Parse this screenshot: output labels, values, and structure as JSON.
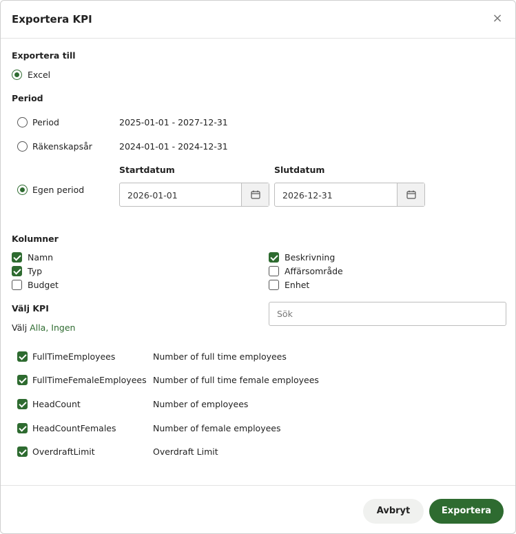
{
  "dialog": {
    "title": "Exportera KPI",
    "close_symbol": "×"
  },
  "export_to": {
    "label": "Exportera till",
    "option": "Excel"
  },
  "period": {
    "label": "Period",
    "options": [
      {
        "label": "Period",
        "range": "2025-01-01 - 2027-12-31"
      },
      {
        "label": "Räkenskapsår",
        "range": "2024-01-01 - 2024-12-31"
      },
      {
        "label": "Egen period"
      }
    ],
    "start_label": "Startdatum",
    "end_label": "Slutdatum",
    "start_value": "2026-01-01",
    "end_value": "2026-12-31"
  },
  "columns": {
    "label": "Kolumner",
    "items": [
      {
        "label": "Namn",
        "checked": true
      },
      {
        "label": "Typ",
        "checked": true
      },
      {
        "label": "Budget",
        "checked": false
      },
      {
        "label": "Beskrivning",
        "checked": true
      },
      {
        "label": "Affärsområde",
        "checked": false
      },
      {
        "label": "Enhet",
        "checked": false
      }
    ]
  },
  "kpi": {
    "label": "Välj KPI",
    "select_prefix": "Välj",
    "select_all": "Alla,",
    "select_none": "Ingen",
    "search_placeholder": "Sök",
    "items": [
      {
        "name": "FullTimeEmployees",
        "description": "Number of full time employees"
      },
      {
        "name": "FullTimeFemaleEmployees",
        "description": "Number of full time female employees"
      },
      {
        "name": "HeadCount",
        "description": "Number of employees"
      },
      {
        "name": "HeadCountFemales",
        "description": "Number of female employees"
      },
      {
        "name": "OverdraftLimit",
        "description": "Overdraft Limit"
      }
    ]
  },
  "footer": {
    "cancel_label": "Avbryt",
    "export_label": "Exportera"
  },
  "colors": {
    "accent": "#2e6b30"
  }
}
